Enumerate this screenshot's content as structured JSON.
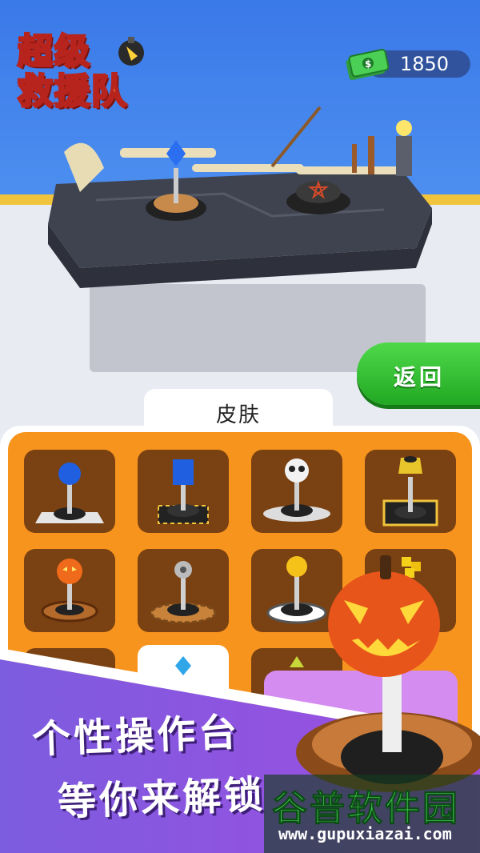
{
  "game": {
    "logo_line1": "超级",
    "logo_line2": "救援队"
  },
  "hud": {
    "currency_icon": "cash-icon",
    "currency_amount": "1850"
  },
  "buttons": {
    "back_label": "返回"
  },
  "skin_panel": {
    "tab_label": "皮肤",
    "items": [
      {
        "name": "blue-ball-joystick",
        "selected": false
      },
      {
        "name": "blue-block-joystick",
        "selected": false
      },
      {
        "name": "skeleton-joystick",
        "selected": false
      },
      {
        "name": "yellow-hex-joystick",
        "selected": false
      },
      {
        "name": "pumpkin-joystick",
        "selected": false
      },
      {
        "name": "gear-joystick",
        "selected": false
      },
      {
        "name": "yellow-ball-joystick",
        "selected": false
      },
      {
        "name": "gold-cube-joystick",
        "selected": false
      },
      {
        "name": "partial-item-1",
        "selected": false
      },
      {
        "name": "blue-gem-joystick",
        "selected": true
      },
      {
        "name": "partial-item-3",
        "selected": false
      }
    ]
  },
  "promo": {
    "line1": "个性操作台",
    "line2": "等你来解锁"
  },
  "watermark": {
    "title": "谷普软件园",
    "url": "www.gupuxiazai.com"
  },
  "colors": {
    "sky": "#3a79e8",
    "panel_orange": "#f7941e",
    "slot_brown": "#7a4112",
    "back_green": "#22a823",
    "promo_purple": "#7b55d6"
  }
}
